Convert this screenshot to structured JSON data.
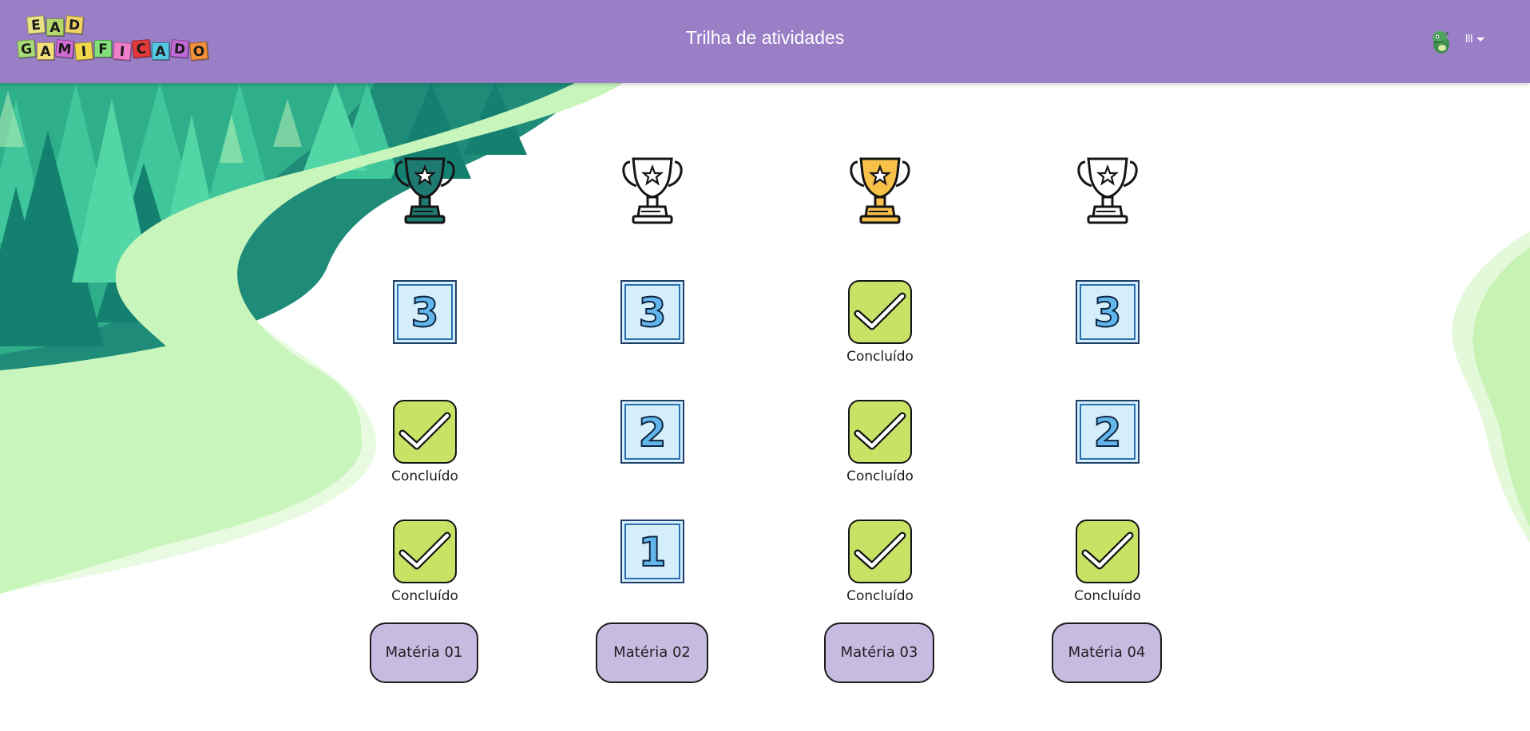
{
  "header": {
    "title": "Trilha de atividades",
    "logo": {
      "line1": [
        "E",
        "A",
        "D"
      ],
      "line2": [
        "G",
        "A",
        "M",
        "I",
        "F",
        "I",
        "C",
        "A",
        "D",
        "O"
      ],
      "colors_line1": [
        "#eae38a",
        "#b5d86b",
        "#f2d265"
      ],
      "colors_line2": [
        "#a9dc78",
        "#f4e07a",
        "#d16cd6",
        "#f1d84a",
        "#83e07a",
        "#f17ec9",
        "#e63a3a",
        "#54c8e3",
        "#c26ad8",
        "#f3913a"
      ]
    },
    "user_menu_label": "lll",
    "avatar_icon": "green-dino-avatar-icon"
  },
  "colors": {
    "header_bg": "#9a7fc7",
    "check_green": "#c7e265",
    "number_blue": "#d4eefb",
    "trophy_gold": "#f8c14a",
    "trophy_teal": "#1f7a71",
    "subject_button": "#c8bbe2"
  },
  "columns": [
    {
      "trophy": "teal",
      "subject_label": "Matéria 01",
      "steps": [
        {
          "type": "number",
          "value": "3"
        },
        {
          "type": "done",
          "label": "Concluído"
        },
        {
          "type": "done",
          "label": "Concluído"
        }
      ]
    },
    {
      "trophy": "white",
      "subject_label": "Matéria 02",
      "steps": [
        {
          "type": "number",
          "value": "3"
        },
        {
          "type": "number",
          "value": "2"
        },
        {
          "type": "number",
          "value": "1"
        }
      ]
    },
    {
      "trophy": "gold",
      "subject_label": "Matéria 03",
      "steps": [
        {
          "type": "done",
          "label": "Concluído"
        },
        {
          "type": "done",
          "label": "Concluído"
        },
        {
          "type": "done",
          "label": "Concluído"
        }
      ]
    },
    {
      "trophy": "white",
      "subject_label": "Matéria 04",
      "steps": [
        {
          "type": "number",
          "value": "3"
        },
        {
          "type": "number",
          "value": "2"
        },
        {
          "type": "done",
          "label": "Concluído"
        }
      ]
    }
  ]
}
